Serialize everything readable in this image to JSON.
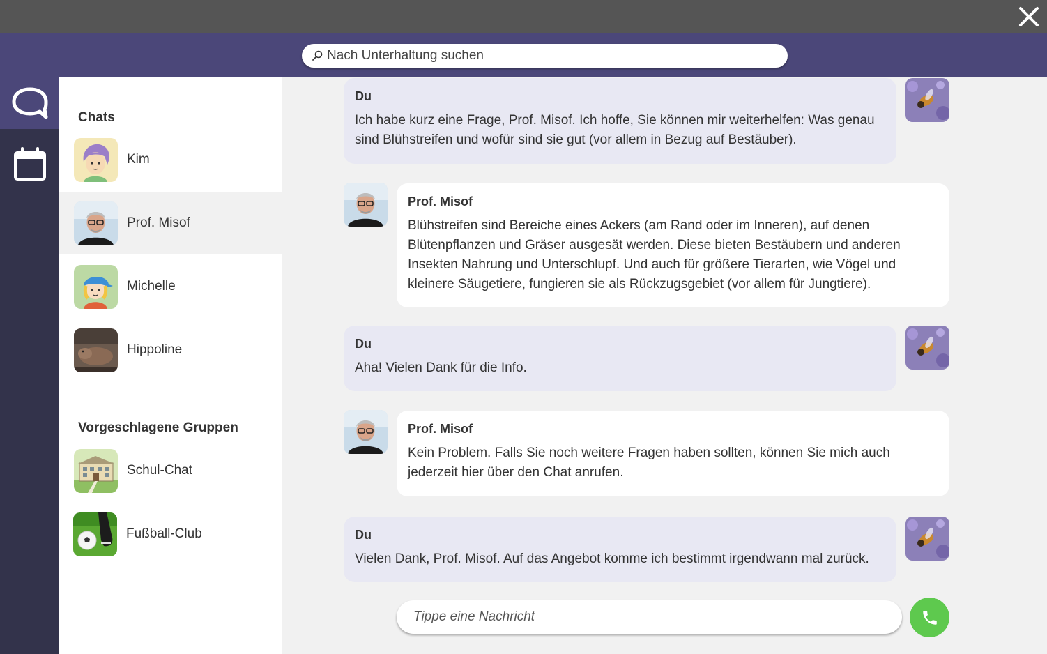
{
  "search": {
    "placeholder": "Nach Unterhaltung suchen"
  },
  "nav": {
    "chat_icon": "chat-bubble-icon",
    "calendar_icon": "calendar-icon"
  },
  "sidebar": {
    "chats_title": "Chats",
    "chats": [
      {
        "name": "Kim",
        "avatar": "illustrated-girl-avatar"
      },
      {
        "name": "Prof. Misof",
        "avatar": "man-with-glasses-photo"
      },
      {
        "name": "Michelle",
        "avatar": "illustrated-kid-cap-avatar"
      },
      {
        "name": "Hippoline",
        "avatar": "hippo-photo"
      }
    ],
    "groups_title": "Vorgeschlagene Gruppen",
    "groups": [
      {
        "name": "Schul-Chat",
        "avatar": "school-building-illustration"
      },
      {
        "name": "Fußball-Club",
        "avatar": "soccer-ball-photo"
      }
    ]
  },
  "messages": [
    {
      "sender": "Du",
      "text": "Ich habe kurz eine Frage, Prof. Misof. Ich hoffe, Sie können mir weiterhelfen: Was genau sind Blühstreifen und wofür sind sie gut (vor allem in Bezug auf Bestäuber).",
      "side": "me"
    },
    {
      "sender": "Prof. Misof",
      "text": "Blühstreifen sind Bereiche eines Ackers (am Rand oder im Inneren), auf denen Blütenpflanzen und Gräser ausgesät werden. Diese bieten Bestäubern und anderen Insekten Nahrung und Unterschlupf. Und auch für größere Tierarten, wie Vögel und kleinere Säugetiere, fungieren sie als Rückzugsgebiet (vor allem für Jungtiere).",
      "side": "them"
    },
    {
      "sender": "Du",
      "text": "Aha! Vielen Dank für die Info.",
      "side": "me"
    },
    {
      "sender": "Prof. Misof",
      "text": "Kein Problem. Falls Sie noch weitere Fragen haben sollten, können Sie mich auch jederzeit hier über den Chat anrufen.",
      "side": "them"
    },
    {
      "sender": "Du",
      "text": "Vielen Dank, Prof. Misof. Auf das Angebot komme ich bestimmt irgendwann mal zurück.",
      "side": "me"
    }
  ],
  "composer": {
    "placeholder": "Tippe eine Nachricht"
  },
  "colors": {
    "accent": "#4b4779",
    "rail": "#33334b",
    "topbar": "#555555",
    "call": "#5ec94e",
    "my_bubble": "#e8e8f3"
  }
}
